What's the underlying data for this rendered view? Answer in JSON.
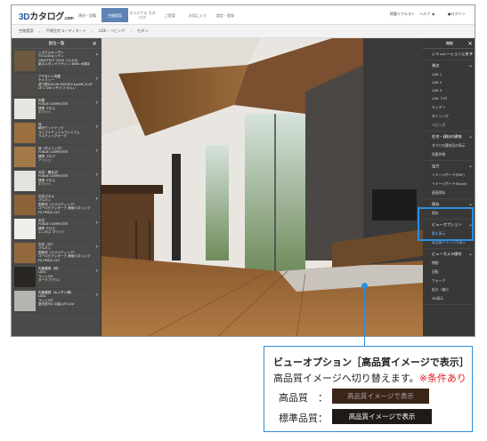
{
  "header": {
    "logo": {
      "mark": "3D",
      "text": "カタログ",
      "suffix": ".com"
    },
    "nav": [
      {
        "label": "建材・設備"
      },
      {
        "label": "空間提案",
        "active": true
      },
      {
        "label": "オリジナル カタログ"
      },
      {
        "label": "ご提案"
      },
      {
        "label": "お気に入り"
      },
      {
        "label": "設定・登録"
      }
    ],
    "right": {
      "request": "掲載リクエスト",
      "help": "ヘルプ",
      "login_label": "ログイン"
    }
  },
  "breadcrumb": [
    "空間提案",
    "戸建住宅コーディネート",
    "LDK・リビング",
    "モダン"
  ],
  "left_panel": {
    "title": "部位一覧",
    "items": [
      {
        "part": "システムキッチン",
        "lines": [
          "TOCLASキッチン",
          "GRAFTECT 2020 イルカの",
          "肌のスタンドデザイン 3600 木調手"
        ],
        "color": "#6e5a40"
      },
      {
        "part": "アクセント内壁",
        "lines": [
          "ケイミュー",
          "塗り壁HOLON 50X300 typeR_FLAT",
          "LK 2 1W ハザミ 2 カルン"
        ],
        "color": "#4f4c48"
      },
      {
        "part": "内壁",
        "lines": [
          "FUKUE COMPUTER",
          "標準 クロス",
          "ホワイト"
        ],
        "color": "#e8e6e0"
      },
      {
        "part": "床",
        "lines": [
          "朝日ウッドテック",
          "ライブナチュラルプレミアム",
          "ラスティックオーク"
        ],
        "color": "#9b6f3f"
      },
      {
        "part": "床（ダイニング）",
        "lines": [
          "FUKUE COMPUTER",
          "標準 フロア",
          "アッシュ"
        ],
        "color": "#a47949"
      },
      {
        "part": "天井・間仕切",
        "lines": [
          "FUKUE COMPUTER",
          "標準 クロス",
          "ホワイト"
        ],
        "color": "#e4e2dc"
      },
      {
        "part": "天井パネル",
        "lines": [
          "マルホン",
          "国産材（ドメスティック）",
          "ユーロピアンオーク 無垢パネリング",
          "FS PMGS-122"
        ],
        "color": "#8c6238"
      },
      {
        "part": "天井",
        "lines": [
          "FUKUE COMPUTER",
          "標準 クロス",
          "エンボス ホワイト"
        ],
        "color": "#f0efeb"
      },
      {
        "part": "天井（2F）",
        "lines": [
          "マルホン",
          "国産材（ドメスティック）",
          "ユーロピアンオーク 無垢パネリング",
          "FS PMGS-122"
        ],
        "color": "#93683c"
      },
      {
        "part": "内部建具（枠）",
        "lines": [
          "LIXIL",
          "ラシッサS",
          "ダークブラウン"
        ],
        "color": "#2a2622"
      },
      {
        "part": "内部建具（キッチン側）",
        "lines": [
          "LIXIL",
          "ラシッサS",
          "室内窓FIX 引違い戸 LGA"
        ],
        "color": "#b6b4b0"
      }
    ]
  },
  "right_panel": {
    "title": "機能",
    "sections": [
      {
        "heading": "シミュレーションに戻す",
        "items": []
      },
      {
        "heading": "視点",
        "items": [
          "LDK 1",
          "LDK 2",
          "LDK 3",
          "LDK（2F）",
          "キッチン",
          "ダイニング",
          "リビング"
        ]
      },
      {
        "heading": "住宅・建材の建物",
        "items": [
          "すべての建材品の表示",
          "所要作物"
        ]
      },
      {
        "heading": "出力",
        "items": [
          "イメージボード(PDF)",
          "イメージボード(Excel)",
          "画面保存"
        ]
      },
      {
        "heading": "保存",
        "items": [
          "保存"
        ]
      },
      {
        "heading": "ビューオプション",
        "items": [
          "影を表示",
          "高品質イメージで表示"
        ]
      },
      {
        "heading": "ビューカメラ操作",
        "items": [
          "移動",
          "回転",
          "ウォーク",
          "拡大・縮小",
          "3D表示"
        ]
      }
    ]
  },
  "callout": {
    "title": "ビューオプション［高品質イメージで表示］",
    "subtitle": "高品質イメージへ切り替えます。",
    "note": "※条件あり",
    "rows": [
      {
        "label": "高品質　：",
        "button": "高品質イメージで表示"
      },
      {
        "label": "標準品質：",
        "button": "高品質イメージで表示"
      }
    ]
  },
  "colors": {
    "accent": "#2b8ee0",
    "nav_active": "#5f83b5",
    "note_red": "#e0202a"
  }
}
